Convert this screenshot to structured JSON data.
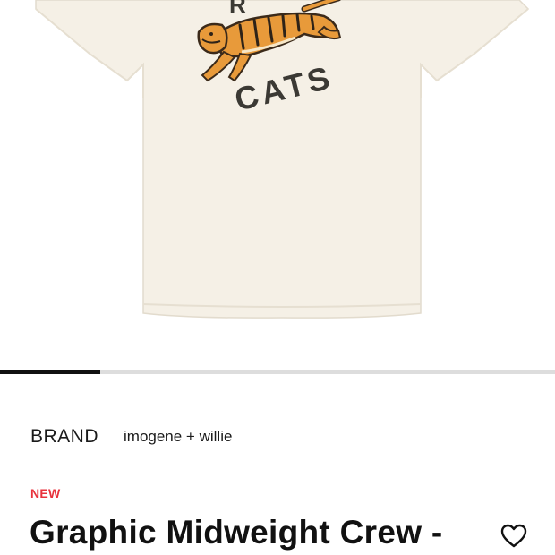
{
  "product_image": {
    "graphic_text_top": "R",
    "graphic_text_bottom": "CATS",
    "shirt_color": "#f5f0e6",
    "alt_icon": "tiger-graphic-tshirt"
  },
  "gallery": {
    "progress_fraction": 0.18
  },
  "details": {
    "brand_label": "BRAND",
    "brand_value": "imogene + willie",
    "badge": "NEW",
    "title": "Graphic Midweight Crew -"
  },
  "icons": {
    "wishlist": "heart-icon"
  },
  "colors": {
    "badge": "#e8323c",
    "text": "#111111",
    "progress_fill": "#111111",
    "progress_track": "#dddddd"
  }
}
